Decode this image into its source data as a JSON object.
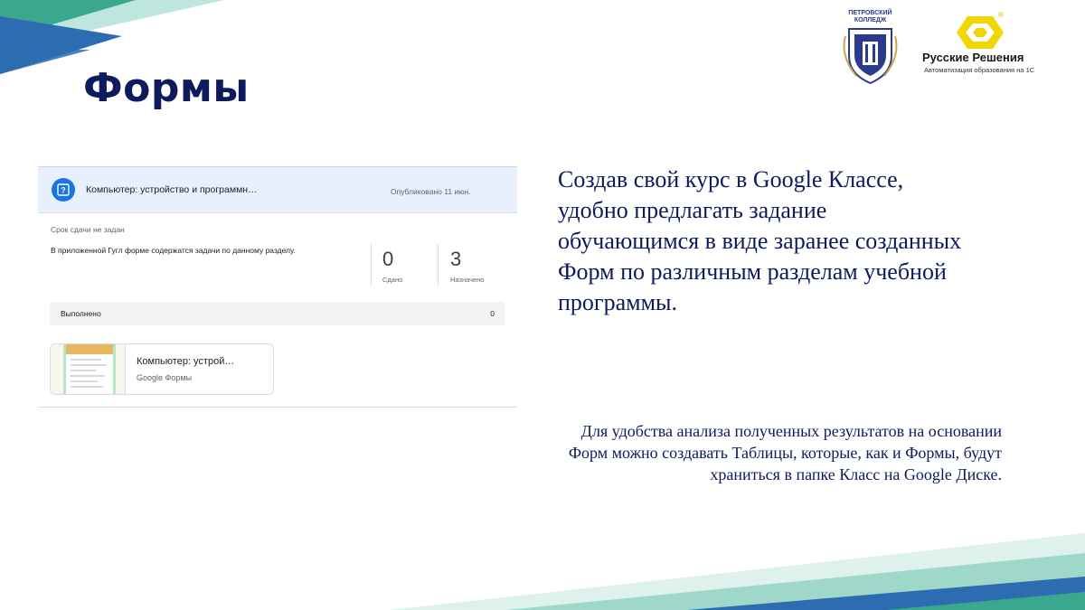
{
  "slide": {
    "title": "Формы",
    "main_text": "Создав свой курс в Google Классе, удобно предлагать задание обучающимся в виде заранее созданных Форм по различным разделам учебной программы.",
    "note_text": "Для удобства анализа полученных результатов на основании Форм можно создавать Таблицы, которые, как и Формы, будут храниться в папке Класс на Google Диске."
  },
  "logos": {
    "college": "ПЕТРОВСКИЙ КОЛЛЕДЖ",
    "company": "Русские Решения",
    "company_tagline": "Автоматизация образования на 1С",
    "company_registered": "®"
  },
  "assignment": {
    "icon": "assignment-question-icon",
    "title": "Компьютер: устройство и программн…",
    "published": "Опубликовано 11 июн.",
    "due": "Срок сдачи не задан",
    "description": "В приложенной Гугл форме содержатся задачи по данному разделу.",
    "stats": [
      {
        "count": "0",
        "label": "Сдано"
      },
      {
        "count": "3",
        "label": "Назначено"
      }
    ],
    "done": {
      "label": "Выполнено",
      "count": "0"
    },
    "attachment": {
      "title": "Компьютер: устрой…",
      "type": "Google Формы"
    }
  },
  "colors": {
    "title": "#0d1b5e",
    "header_bg": "#e8f0fe",
    "accent_blue": "#1a73e8",
    "deco_teal": "#3aa88e",
    "deco_blue": "#2d6cb0",
    "logo_yellow": "#f2d600"
  }
}
